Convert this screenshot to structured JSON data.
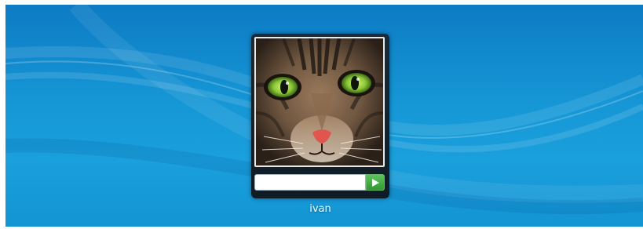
{
  "login": {
    "username": "ivan",
    "password_value": "",
    "submit_icon": "arrow-right-icon",
    "avatar_icon": "cat-face-avatar"
  },
  "colors": {
    "background": "#1697d6",
    "panel": "#14242f",
    "submit_button": "#3aa83a"
  }
}
